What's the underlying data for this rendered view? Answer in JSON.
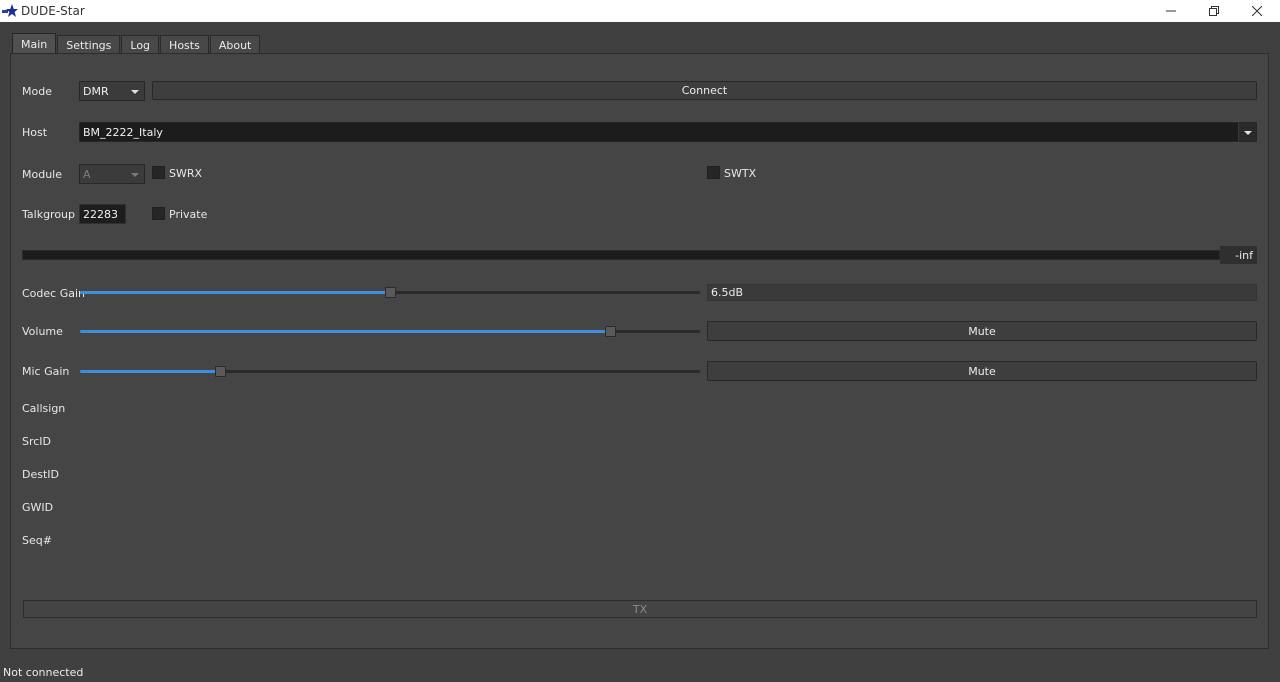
{
  "window": {
    "title": "DUDE-Star"
  },
  "tabs": [
    {
      "label": "Main"
    },
    {
      "label": "Settings"
    },
    {
      "label": "Log"
    },
    {
      "label": "Hosts"
    },
    {
      "label": "About"
    }
  ],
  "main": {
    "mode_label": "Mode",
    "mode_value": "DMR",
    "connect_label": "Connect",
    "host_label": "Host",
    "host_value": "BM_2222_Italy",
    "module_label": "Module",
    "module_value": "A",
    "swrx_label": "SWRX",
    "swrx_checked": false,
    "swtx_label": "SWTX",
    "swtx_checked": false,
    "talkgroup_label": "Talkgroup",
    "talkgroup_value": "22283",
    "private_label": "Private",
    "private_checked": false,
    "level_readout": "-inf",
    "codec_gain_label": "Codec Gain",
    "codec_gain_value": "6.5dB",
    "codec_gain_fraction": 0.5,
    "volume_label": "Volume",
    "volume_fraction": 0.855,
    "volume_mute_label": "Mute",
    "mic_gain_label": "Mic Gain",
    "mic_gain_fraction": 0.225,
    "mic_mute_label": "Mute",
    "info_labels": {
      "callsign": "Callsign",
      "srcid": "SrcID",
      "destid": "DestID",
      "gwid": "GWID",
      "seq": "Seq#"
    },
    "tx_label": "TX"
  },
  "status_bar": {
    "text": "Not connected"
  },
  "colors": {
    "accent": "#3d8ee0",
    "background": "#404040"
  }
}
